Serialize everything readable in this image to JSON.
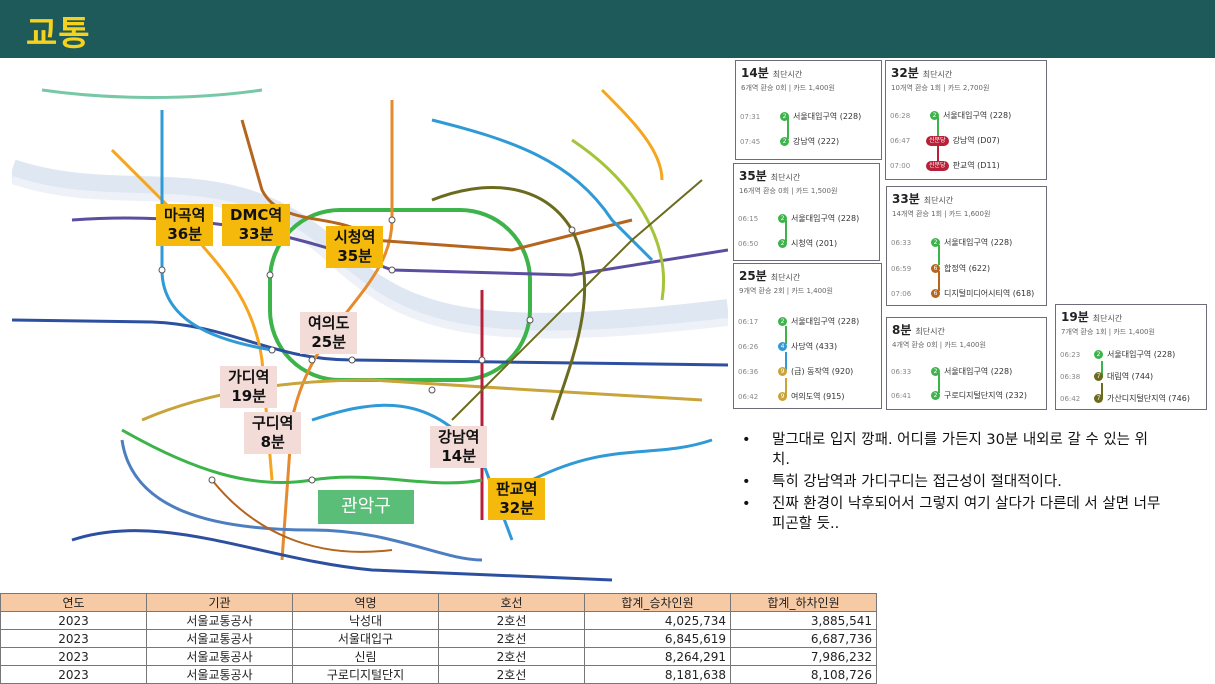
{
  "page": {
    "title": "교통"
  },
  "map": {
    "region_label": "관악구",
    "tags": [
      {
        "name": "마곡역",
        "time": "36분"
      },
      {
        "name": "DMC역",
        "time": "33분"
      },
      {
        "name": "시청역",
        "time": "35분"
      },
      {
        "name": "여의도",
        "time": "25분"
      },
      {
        "name": "가디역",
        "time": "19분"
      },
      {
        "name": "구디역",
        "time": "8분"
      },
      {
        "name": "강남역",
        "time": "14분"
      },
      {
        "name": "판교역",
        "time": "32분"
      }
    ]
  },
  "routes": [
    {
      "time": "14분",
      "label": "최단시간",
      "summary": "6개역 환승 0회 | 카드 1,400원",
      "stops": [
        {
          "t": "07:31",
          "line": "2",
          "name": "서울대입구역 (228)"
        },
        {
          "t": "07:45",
          "line": "2",
          "name": "강남역 (222)"
        }
      ]
    },
    {
      "time": "32분",
      "label": "최단시간",
      "summary": "10개역 환승 1회 | 카드 2,700원",
      "stops": [
        {
          "t": "06:28",
          "line": "2",
          "name": "서울대입구역 (228)"
        },
        {
          "t": "06:47",
          "line": "신분당",
          "name": "강남역 (D07)"
        },
        {
          "t": "07:00",
          "line": "신분당",
          "name": "판교역 (D11)"
        }
      ]
    },
    {
      "time": "35분",
      "label": "최단시간",
      "summary": "16개역 환승 0회 | 카드 1,500원",
      "stops": [
        {
          "t": "06:15",
          "line": "2",
          "name": "서울대입구역 (228)"
        },
        {
          "t": "06:50",
          "line": "2",
          "name": "시청역 (201)"
        }
      ]
    },
    {
      "time": "33분",
      "label": "최단시간",
      "summary": "14개역 환승 1회 | 카드 1,600원",
      "stops": [
        {
          "t": "06:33",
          "line": "2",
          "name": "서울대입구역 (228)"
        },
        {
          "t": "06:59",
          "line": "6",
          "name": "합정역 (622)"
        },
        {
          "t": "07:06",
          "line": "6",
          "name": "디지털미디어시티역 (618)"
        }
      ]
    },
    {
      "time": "25분",
      "label": "최단시간",
      "summary": "9개역 환승 2회 | 카드 1,400원",
      "stops": [
        {
          "t": "06:17",
          "line": "2",
          "name": "서울대입구역 (228)"
        },
        {
          "t": "06:26",
          "line": "4",
          "name": "사당역 (433)"
        },
        {
          "t": "06:36",
          "line": "9",
          "name": "(급) 동작역 (920)"
        },
        {
          "t": "06:42",
          "line": "9",
          "name": "여의도역 (915)"
        }
      ]
    },
    {
      "time": "8분",
      "label": "최단시간",
      "summary": "4개역 환승 0회 | 카드 1,400원",
      "stops": [
        {
          "t": "06:33",
          "line": "2",
          "name": "서울대입구역 (228)"
        },
        {
          "t": "06:41",
          "line": "2",
          "name": "구로디지털단지역 (232)"
        }
      ]
    },
    {
      "time": "19분",
      "label": "최단시간",
      "summary": "7개역 환승 1회 | 카드 1,400원",
      "stops": [
        {
          "t": "06:23",
          "line": "2",
          "name": "서울대입구역 (228)"
        },
        {
          "t": "06:38",
          "line": "7",
          "name": "대림역 (744)"
        },
        {
          "t": "06:42",
          "line": "7",
          "name": "가산디지털단지역 (746)"
        }
      ]
    }
  ],
  "line_colors": {
    "2": "#3cb44a",
    "4": "#2f9ad6",
    "6": "#b5651d",
    "7": "#6b6b1f",
    "9": "#c9a43a",
    "신분당": "#b8203a"
  },
  "bullets": [
    "말그대로 입지 깡패. 어디를 가든지 30분 내외로 갈 수 있는 위치.",
    "특히 강남역과 가디구디는 접근성이 절대적이다.",
    "진짜 환경이 낙후되어서  그렇지 여기 살다가 다른데 서 살면 너무 피곤할 듯.."
  ],
  "table": {
    "headers": [
      "연도",
      "기관",
      "역명",
      "호선",
      "합계_승차인원",
      "합계_하차인원"
    ],
    "rows": [
      [
        "2023",
        "서울교통공사",
        "낙성대",
        "2호선",
        "4,025,734",
        "3,885,541"
      ],
      [
        "2023",
        "서울교통공사",
        "서울대입구",
        "2호선",
        "6,845,619",
        "6,687,736"
      ],
      [
        "2023",
        "서울교통공사",
        "신림",
        "2호선",
        "8,264,291",
        "7,986,232"
      ],
      [
        "2023",
        "서울교통공사",
        "구로디지털단지",
        "2호선",
        "8,181,638",
        "8,108,726"
      ]
    ]
  }
}
